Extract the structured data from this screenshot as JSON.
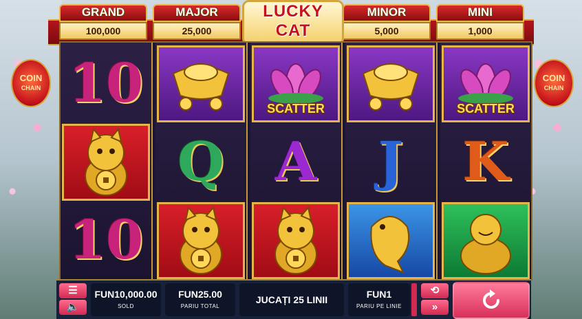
{
  "jackpots": [
    {
      "label": "GRAND",
      "value": "100,000"
    },
    {
      "label": "MAJOR",
      "value": "25,000"
    },
    {
      "label": "MINOR",
      "value": "5,000"
    },
    {
      "label": "MINI",
      "value": "1,000"
    }
  ],
  "logo": {
    "line1": "LUCKY",
    "line2": "CAT"
  },
  "side_badge": {
    "line1": "COIN",
    "line2": "CHAIN"
  },
  "reels": [
    [
      {
        "symbol": "10",
        "bg": "none"
      },
      {
        "symbol": "lucky-cat",
        "bg": "red"
      },
      {
        "symbol": "10",
        "bg": "none"
      }
    ],
    [
      {
        "symbol": "gold-ingot",
        "bg": "purple"
      },
      {
        "symbol": "Q",
        "bg": "none"
      },
      {
        "symbol": "lucky-cat",
        "bg": "red"
      }
    ],
    [
      {
        "symbol": "lotus",
        "bg": "purple",
        "label": "SCATTER"
      },
      {
        "symbol": "A",
        "bg": "none"
      },
      {
        "symbol": "lucky-cat",
        "bg": "red"
      }
    ],
    [
      {
        "symbol": "gold-ingot",
        "bg": "purple"
      },
      {
        "symbol": "J",
        "bg": "none"
      },
      {
        "symbol": "koi-fish",
        "bg": "blue"
      }
    ],
    [
      {
        "symbol": "lotus",
        "bg": "purple",
        "label": "SCATTER"
      },
      {
        "symbol": "K",
        "bg": "none"
      },
      {
        "symbol": "buddha",
        "bg": "green"
      }
    ]
  ],
  "controls": {
    "balance_value": "FUN10,000.00",
    "balance_caption": "SOLD",
    "total_bet_value": "FUN25.00",
    "total_bet_caption": "PARIU TOTAL",
    "lines_label": "JUCAȚI 25 LINII",
    "line_bet_value": "FUN1",
    "line_bet_caption": "PARIU PE LINIE"
  },
  "icons": [
    "menu-icon",
    "sound-icon",
    "autoplay-icon",
    "turbo-icon",
    "spin-icon"
  ],
  "colors": {
    "accent": "#d02a50",
    "frame_gold": "#d4a53a",
    "frame_red": "#b4141c"
  }
}
